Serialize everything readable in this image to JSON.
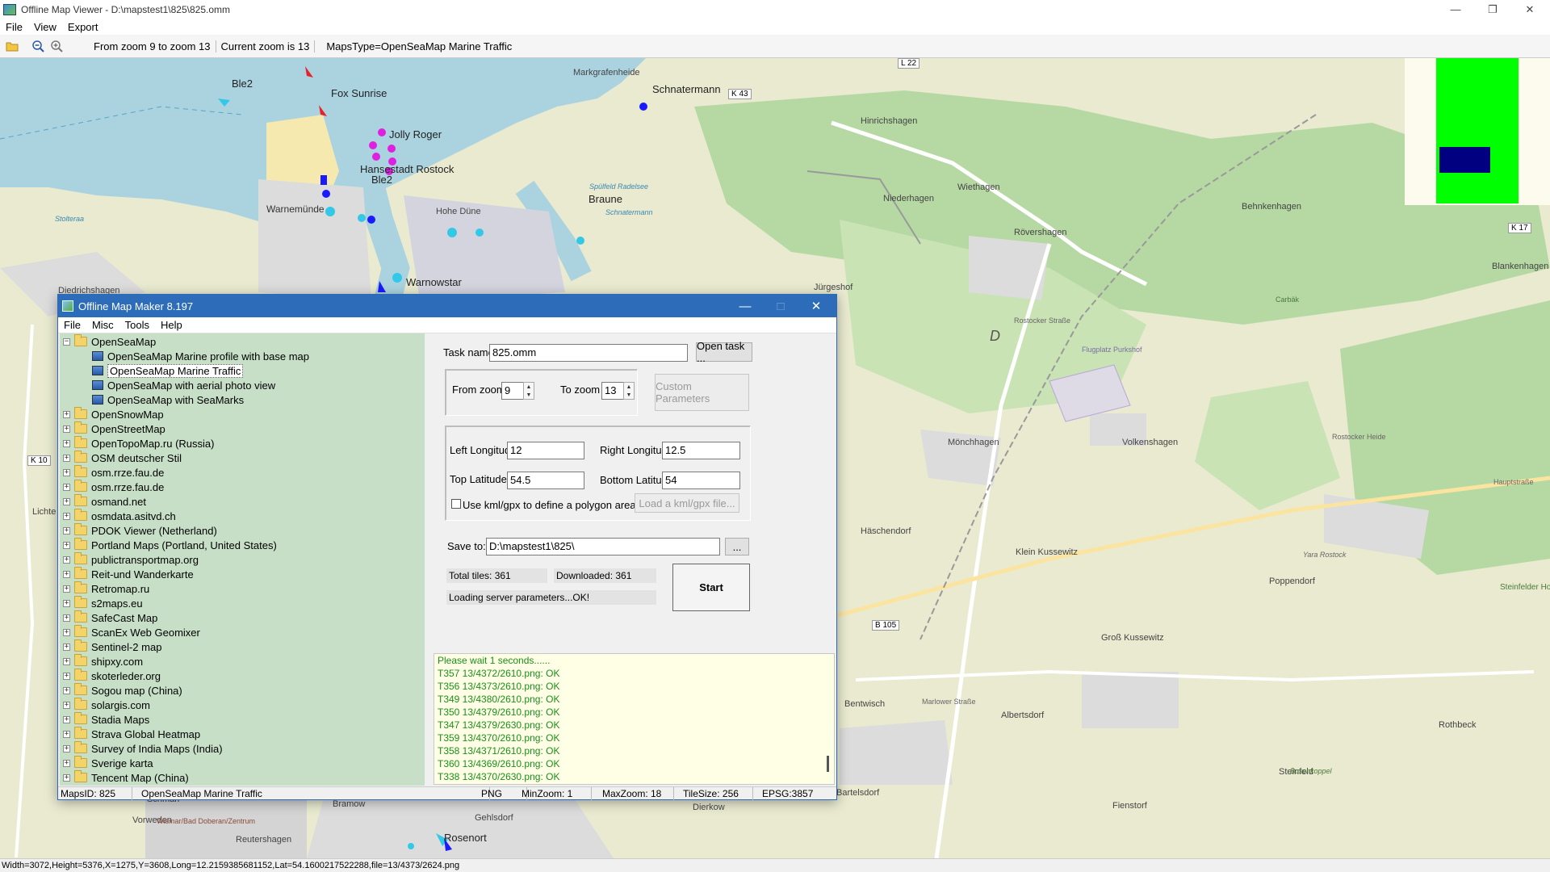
{
  "app": {
    "title": "Offline Map Viewer - D:\\mapstest1\\825\\825.omm",
    "menu": [
      "File",
      "View",
      "Export"
    ],
    "controls": {
      "minimize": "—",
      "restore": "❐",
      "close": "✕"
    }
  },
  "toolbar": {
    "zoom_range": "From zoom 9 to zoom 13",
    "current_zoom": "Current zoom is 13",
    "maps_type": "MapsType=OpenSeaMap Marine Traffic"
  },
  "map": {
    "colors": {
      "sea": "#aad3df",
      "land": "#e9ead0",
      "forest": "#b6d9a4",
      "urban": "#dcdcdc",
      "road": "#ffffff",
      "major_road": "#fbe4a0"
    },
    "ship_labels": [
      {
        "text": "Ble2",
        "color": "#33c8e8"
      },
      {
        "text": "Fox Sunrise",
        "color": "#e8202a"
      },
      {
        "text": "Jolly Roger",
        "color": "#e020e0"
      },
      {
        "text": "Hansestadt Rostock",
        "color": "#1a1aff"
      },
      {
        "text": "Ble2",
        "color": "#0000cc"
      },
      {
        "text": "Schnatermann",
        "color": "#1a1aff"
      },
      {
        "text": "Braune",
        "color": "#33c8e8"
      },
      {
        "text": "Warnowstar",
        "color": "#33c8e8"
      },
      {
        "text": "Rosenort",
        "color": "#1a1aff"
      }
    ],
    "place_labels": [
      "Markgrafenheide",
      "Hinrichshagen",
      "Niederhagen",
      "Wiethagen",
      "Behnkenhagen",
      "Blankenhagen",
      "Warnemünde",
      "Hohe Düne",
      "Rövershagen",
      "Jürgeshof",
      "Diedrichshagen",
      "Mönchhagen",
      "Volkenshagen",
      "Häschendorf",
      "Klein Kussewitz",
      "Poppendorf",
      "Groß Kussewitz",
      "Bentwisch",
      "Albertsdorf",
      "Rothbeck",
      "Steinfeld",
      "Fienstorf",
      "Dierkow",
      "Gehlsdorf",
      "Bramow",
      "Reutershagen",
      "Vorweden",
      "Schmarl",
      "Lichte",
      "Bartelsdorf",
      "Flugplatz Purkshof",
      "Yara Rostock",
      "Steinfelder Holz",
      "Carbäk",
      "Buschkoppel",
      "Spülfeld Radelsee",
      "Stolteraa",
      "Schnatermann",
      "Marlower Straße",
      "Rostocker Heide",
      "Rostocker Straße",
      "Hauptstraße",
      "Wismar/Bad Doberan/Zentrum"
    ],
    "road_shields": [
      "L 22",
      "K 43",
      "K 17",
      "K 10",
      "B 105"
    ],
    "glyph": "D",
    "minimap": {
      "background": "#fdfaee",
      "tile_color": "#00ff00",
      "viewport_color": "#000080"
    }
  },
  "status_bar": "Width=3072,Height=5376,X=1275,Y=3608,Long=12.2159385681152,Lat=54.1600217522288,file=13/4373/2624.png",
  "dialog": {
    "title": "Offline Map Maker 8.197",
    "menu": [
      "File",
      "Misc",
      "Tools",
      "Help"
    ],
    "tree": {
      "root": "OpenSeaMap",
      "children": [
        "OpenSeaMap Marine profile with base map",
        "OpenSeaMap Marine Traffic",
        "OpenSeaMap with aerial photo view",
        "OpenSeaMap with SeaMarks"
      ],
      "selected_child": 1,
      "folders": [
        "OpenSnowMap",
        "OpenStreetMap",
        "OpenTopoMap.ru (Russia)",
        "OSM deutscher Stil",
        "osm.rrze.fau.de",
        "osm.rrze.fau.de",
        "osmand.net",
        "osmdata.asitvd.ch",
        "PDOK Viewer (Netherland)",
        "Portland Maps (Portland, United States)",
        "publictransportmap.org",
        "Reit-und Wanderkarte",
        "Retromap.ru",
        "s2maps.eu",
        "SafeCast Map",
        "ScanEx Web Geomixer",
        "Sentinel-2 map",
        "shipxy.com",
        "skoterleder.org",
        "Sogou map (China)",
        "solargis.com",
        "Stadia Maps",
        "Strava Global Heatmap",
        "Survey of India Maps (India)",
        "Sverige karta",
        "Tencent Map (China)"
      ]
    },
    "task": {
      "label": "Task name",
      "value": "825.omm",
      "open_button": "Open task ..."
    },
    "zoom": {
      "from_label": "From zoom",
      "from_value": "9",
      "to_label": "To zoom",
      "to_value": "13",
      "custom_button": "Custom Parameters"
    },
    "bounds": {
      "left_lon_label": "Left Longitude",
      "left_lon": "12",
      "right_lon_label": "Right Longitude",
      "right_lon": "12.5",
      "top_lat_label": "Top Latitude",
      "top_lat": "54.5",
      "bottom_lat_label": "Bottom Latitude",
      "bottom_lat": "54"
    },
    "kml": {
      "checkbox_label": "Use kml/gpx to define a polygon area",
      "checked": false,
      "load_button": "Load a kml/gpx file..."
    },
    "save": {
      "label": "Save to:",
      "value": "D:\\mapstest1\\825\\",
      "browse_button": "..."
    },
    "progress": {
      "total": "Total tiles: 361",
      "downloaded": "Downloaded: 361",
      "status": "Loading server parameters...OK!",
      "start_button": "Start"
    },
    "log": [
      "Please wait 1 seconds......",
      "T357 13/4372/2610.png: OK",
      "T356 13/4373/2610.png: OK",
      "T349 13/4380/2610.png: OK",
      "T350 13/4379/2610.png: OK",
      "T347 13/4379/2630.png: OK",
      "T359 13/4370/2610.png: OK",
      "T358 13/4371/2610.png: OK",
      "T360 13/4369/2610.png: OK",
      "T338 13/4370/2630.png: OK"
    ],
    "status": {
      "maps_id": "MapsID: 825",
      "map_name": "OpenSeaMap Marine Traffic",
      "format": "PNG",
      "min_zoom": "MinZoom: 1",
      "max_zoom": "MaxZoom: 18",
      "tile_size": "TileSize: 256",
      "epsg": "EPSG:3857"
    }
  }
}
